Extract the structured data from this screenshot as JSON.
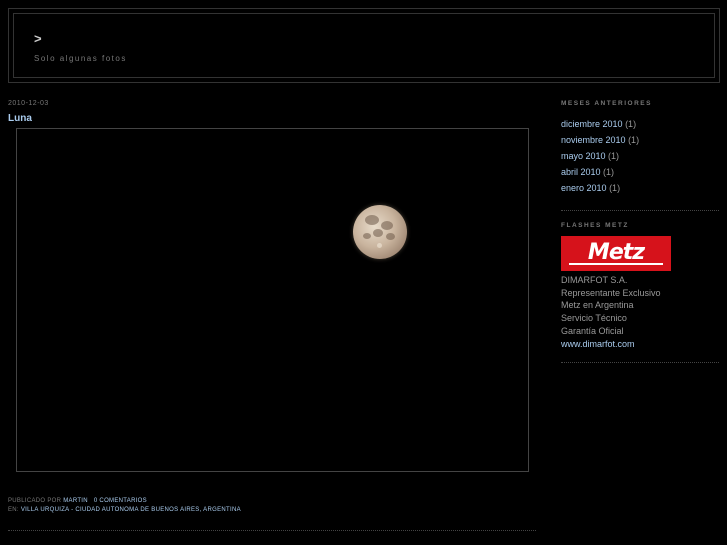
{
  "header": {
    "title": ">",
    "description": "Solo algunas fotos"
  },
  "post": {
    "date": "2010-12-03",
    "title": "Luna",
    "photo_icon": "full-moon-photo",
    "footer": {
      "published_prefix": "PUBLICADO POR",
      "author": "MARTIN",
      "comments": "0 COMENTARIOS",
      "location_prefix": "EN:",
      "location": "VILLA URQUIZA - CIUDAD AUTONOMA DE BUENOS AIRES, ARGENTINA"
    }
  },
  "sidebar": {
    "archive": {
      "heading": "MESES ANTERIORES",
      "items": [
        {
          "label": "diciembre 2010",
          "count": "(1)"
        },
        {
          "label": "noviembre 2010",
          "count": "(1)"
        },
        {
          "label": "mayo 2010",
          "count": "(1)"
        },
        {
          "label": "abril 2010",
          "count": "(1)"
        },
        {
          "label": "enero 2010",
          "count": "(1)"
        }
      ]
    },
    "flashes": {
      "heading": "FLASHES METZ",
      "logo_text": "Metz",
      "lines": [
        "DIMARFOT S.A.",
        "Representante Exclusivo",
        "Metz en Argentina",
        "Servicio Técnico",
        "Garantía Oficial"
      ],
      "link": "www.dimarfot.com"
    }
  },
  "colors": {
    "background": "#000000",
    "link": "#aaccee",
    "muted": "#777777",
    "metz_red": "#d6121b"
  }
}
